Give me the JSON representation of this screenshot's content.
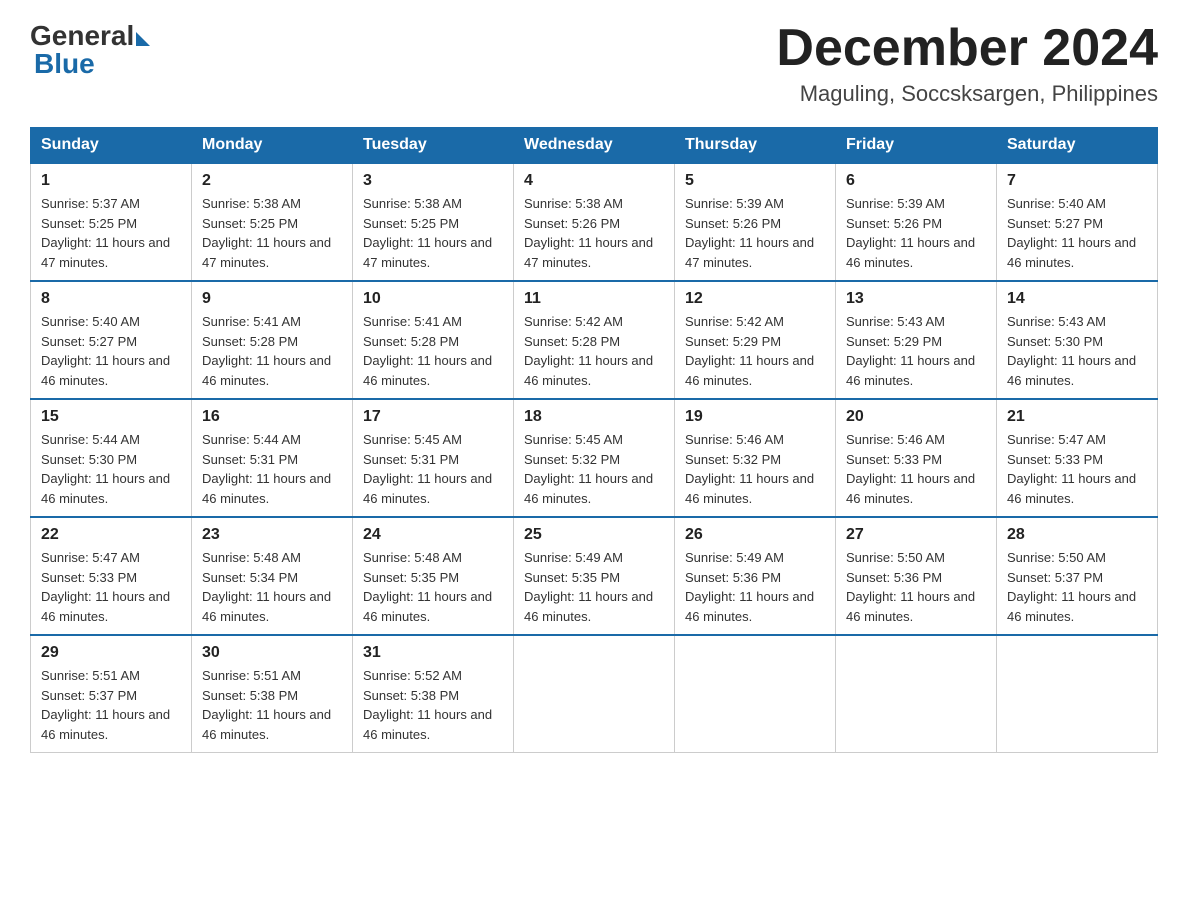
{
  "header": {
    "logo_general": "General",
    "logo_blue": "Blue",
    "title": "December 2024",
    "subtitle": "Maguling, Soccsksargen, Philippines"
  },
  "days_of_week": [
    "Sunday",
    "Monday",
    "Tuesday",
    "Wednesday",
    "Thursday",
    "Friday",
    "Saturday"
  ],
  "weeks": [
    [
      {
        "day": "1",
        "sunrise": "5:37 AM",
        "sunset": "5:25 PM",
        "daylight": "11 hours and 47 minutes."
      },
      {
        "day": "2",
        "sunrise": "5:38 AM",
        "sunset": "5:25 PM",
        "daylight": "11 hours and 47 minutes."
      },
      {
        "day": "3",
        "sunrise": "5:38 AM",
        "sunset": "5:25 PM",
        "daylight": "11 hours and 47 minutes."
      },
      {
        "day": "4",
        "sunrise": "5:38 AM",
        "sunset": "5:26 PM",
        "daylight": "11 hours and 47 minutes."
      },
      {
        "day": "5",
        "sunrise": "5:39 AM",
        "sunset": "5:26 PM",
        "daylight": "11 hours and 47 minutes."
      },
      {
        "day": "6",
        "sunrise": "5:39 AM",
        "sunset": "5:26 PM",
        "daylight": "11 hours and 46 minutes."
      },
      {
        "day": "7",
        "sunrise": "5:40 AM",
        "sunset": "5:27 PM",
        "daylight": "11 hours and 46 minutes."
      }
    ],
    [
      {
        "day": "8",
        "sunrise": "5:40 AM",
        "sunset": "5:27 PM",
        "daylight": "11 hours and 46 minutes."
      },
      {
        "day": "9",
        "sunrise": "5:41 AM",
        "sunset": "5:28 PM",
        "daylight": "11 hours and 46 minutes."
      },
      {
        "day": "10",
        "sunrise": "5:41 AM",
        "sunset": "5:28 PM",
        "daylight": "11 hours and 46 minutes."
      },
      {
        "day": "11",
        "sunrise": "5:42 AM",
        "sunset": "5:28 PM",
        "daylight": "11 hours and 46 minutes."
      },
      {
        "day": "12",
        "sunrise": "5:42 AM",
        "sunset": "5:29 PM",
        "daylight": "11 hours and 46 minutes."
      },
      {
        "day": "13",
        "sunrise": "5:43 AM",
        "sunset": "5:29 PM",
        "daylight": "11 hours and 46 minutes."
      },
      {
        "day": "14",
        "sunrise": "5:43 AM",
        "sunset": "5:30 PM",
        "daylight": "11 hours and 46 minutes."
      }
    ],
    [
      {
        "day": "15",
        "sunrise": "5:44 AM",
        "sunset": "5:30 PM",
        "daylight": "11 hours and 46 minutes."
      },
      {
        "day": "16",
        "sunrise": "5:44 AM",
        "sunset": "5:31 PM",
        "daylight": "11 hours and 46 minutes."
      },
      {
        "day": "17",
        "sunrise": "5:45 AM",
        "sunset": "5:31 PM",
        "daylight": "11 hours and 46 minutes."
      },
      {
        "day": "18",
        "sunrise": "5:45 AM",
        "sunset": "5:32 PM",
        "daylight": "11 hours and 46 minutes."
      },
      {
        "day": "19",
        "sunrise": "5:46 AM",
        "sunset": "5:32 PM",
        "daylight": "11 hours and 46 minutes."
      },
      {
        "day": "20",
        "sunrise": "5:46 AM",
        "sunset": "5:33 PM",
        "daylight": "11 hours and 46 minutes."
      },
      {
        "day": "21",
        "sunrise": "5:47 AM",
        "sunset": "5:33 PM",
        "daylight": "11 hours and 46 minutes."
      }
    ],
    [
      {
        "day": "22",
        "sunrise": "5:47 AM",
        "sunset": "5:33 PM",
        "daylight": "11 hours and 46 minutes."
      },
      {
        "day": "23",
        "sunrise": "5:48 AM",
        "sunset": "5:34 PM",
        "daylight": "11 hours and 46 minutes."
      },
      {
        "day": "24",
        "sunrise": "5:48 AM",
        "sunset": "5:35 PM",
        "daylight": "11 hours and 46 minutes."
      },
      {
        "day": "25",
        "sunrise": "5:49 AM",
        "sunset": "5:35 PM",
        "daylight": "11 hours and 46 minutes."
      },
      {
        "day": "26",
        "sunrise": "5:49 AM",
        "sunset": "5:36 PM",
        "daylight": "11 hours and 46 minutes."
      },
      {
        "day": "27",
        "sunrise": "5:50 AM",
        "sunset": "5:36 PM",
        "daylight": "11 hours and 46 minutes."
      },
      {
        "day": "28",
        "sunrise": "5:50 AM",
        "sunset": "5:37 PM",
        "daylight": "11 hours and 46 minutes."
      }
    ],
    [
      {
        "day": "29",
        "sunrise": "5:51 AM",
        "sunset": "5:37 PM",
        "daylight": "11 hours and 46 minutes."
      },
      {
        "day": "30",
        "sunrise": "5:51 AM",
        "sunset": "5:38 PM",
        "daylight": "11 hours and 46 minutes."
      },
      {
        "day": "31",
        "sunrise": "5:52 AM",
        "sunset": "5:38 PM",
        "daylight": "11 hours and 46 minutes."
      },
      null,
      null,
      null,
      null
    ]
  ],
  "labels": {
    "sunrise_prefix": "Sunrise: ",
    "sunset_prefix": "Sunset: ",
    "daylight_prefix": "Daylight: "
  }
}
